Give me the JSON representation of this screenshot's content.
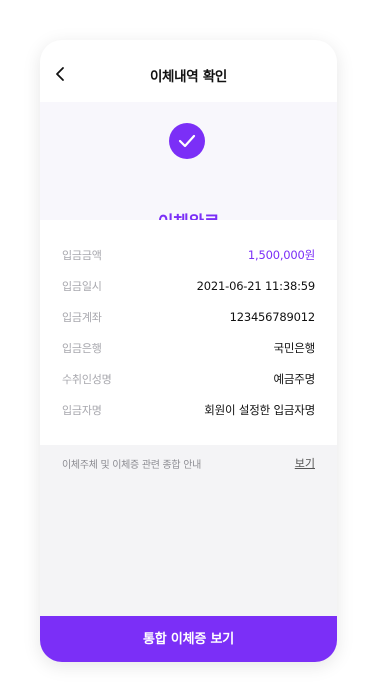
{
  "header": {
    "title": "이체내역 확인",
    "back_icon": "chevron-left-icon"
  },
  "hero": {
    "status_icon": "check-circle-icon",
    "status_text": "이체완료"
  },
  "colors": {
    "accent": "#7b2ff7",
    "label": "#a8a8ae",
    "background": "#f4f4f6"
  },
  "details": [
    {
      "label": "입금금액",
      "value": "1,500,000원"
    },
    {
      "label": "입금일시",
      "value": "2021-06-21 11:38:59"
    },
    {
      "label": "입금계좌",
      "value": "123456789012"
    },
    {
      "label": "입금은행",
      "value": "국민은행"
    },
    {
      "label": "수취인성명",
      "value": "예금주명"
    },
    {
      "label": "입금자명",
      "value": "회원이 설정한 입금자명"
    }
  ],
  "guide": {
    "text": "이체주체 및 이체증 관련 종합 안내",
    "link": "보기"
  },
  "bottom_button": {
    "label": "통합 이체증 보기"
  }
}
